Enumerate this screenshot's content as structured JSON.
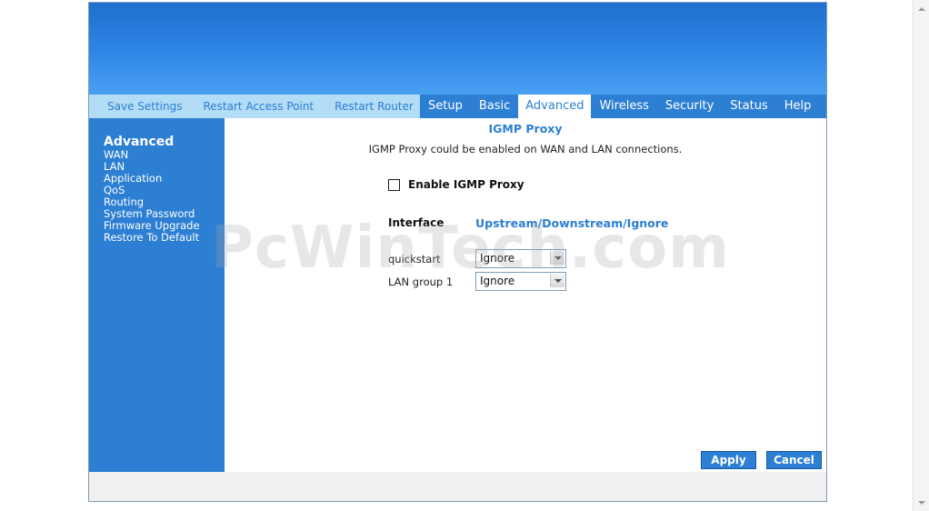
{
  "actions": {
    "save_settings": "Save Settings",
    "restart_ap": "Restart Access Point",
    "restart_router": "Restart Router"
  },
  "tabs": [
    "Setup",
    "Basic",
    "Advanced",
    "Wireless",
    "Security",
    "Status",
    "Help"
  ],
  "active_tab": "Advanced",
  "sidebar": {
    "title": "Advanced",
    "items": [
      "WAN",
      "LAN",
      "Application",
      "QoS",
      "Routing",
      "System Password",
      "Firmware Upgrade",
      "Restore To Default"
    ]
  },
  "content": {
    "title": "IGMP Proxy",
    "description": "IGMP Proxy could be enabled on WAN and LAN connections.",
    "enable_label": "Enable IGMP Proxy",
    "enable_checked": false,
    "interface_header": "Interface",
    "mode_header": "Upstream/Downstream/Ignore",
    "rows": [
      {
        "label": "quickstart",
        "value": "Ignore"
      },
      {
        "label": "LAN group 1",
        "value": "Ignore"
      }
    ]
  },
  "buttons": {
    "apply": "Apply",
    "cancel": "Cancel"
  },
  "watermark": "PcWinTech.com",
  "colors": {
    "accent": "#2d7fd3",
    "link": "#2c7fd2",
    "action_bar": "#b3dcf7"
  }
}
